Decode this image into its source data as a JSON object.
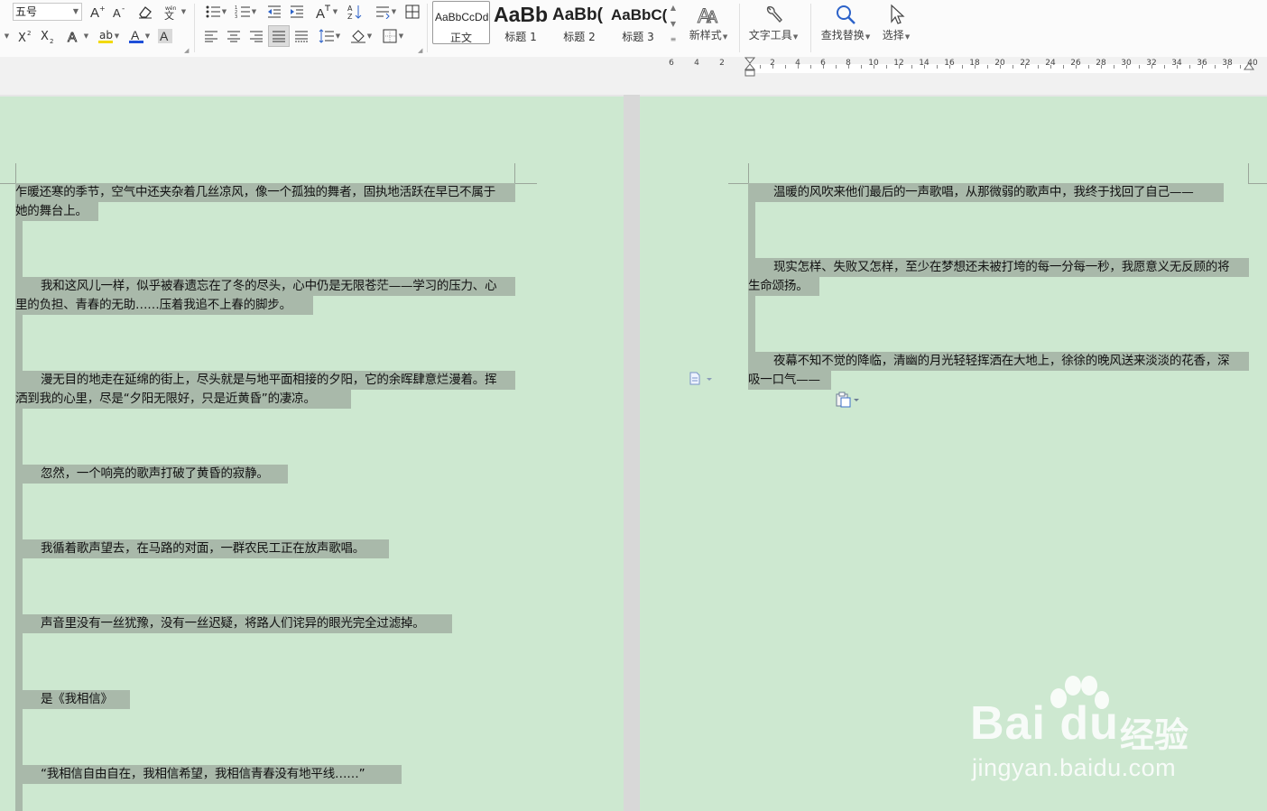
{
  "toolbar": {
    "font_size": "五号",
    "styles": [
      {
        "preview": "AaBbCcDd",
        "label": "正文"
      },
      {
        "preview": "AaBb",
        "label": "标题 1"
      },
      {
        "preview": "AaBb(",
        "label": "标题 2"
      },
      {
        "preview": "AaBbC(",
        "label": "标题 3"
      }
    ],
    "new_style": "新样式",
    "text_tools": "文字工具",
    "find_replace": "查找替换",
    "select": "选择"
  },
  "ruler": {
    "left_numbers": [
      "6",
      "4",
      "2"
    ],
    "right_numbers": [
      "2",
      "4",
      "6",
      "8",
      "10",
      "12",
      "14",
      "16",
      "18",
      "20",
      "22",
      "24",
      "26",
      "28",
      "30",
      "32",
      "34",
      "36",
      "38",
      "40"
    ]
  },
  "left_page": {
    "lines": [
      "乍暖还寒的季节，空气中还夹杂着几丝凉风，像一个孤独的舞者，固执地活跃在早已不属于",
      "她的舞台上。",
      "我和这风儿一样，似乎被春遗忘在了冬的尽头，心中仍是无限苍茫——学习的压力、心",
      "里的负担、青春的无助……压着我追不上春的脚步。",
      "漫无目的地走在延绵的街上，尽头就是与地平面相接的夕阳，它的余晖肆意烂漫着。挥",
      "洒到我的心里，尽是“夕阳无限好，只是近黄昏”的凄凉。",
      "忽然，一个响亮的歌声打破了黄昏的寂静。",
      "我循着歌声望去，在马路的对面，一群农民工正在放声歌唱。",
      "声音里没有一丝犹豫，没有一丝迟疑，将路人们诧异的眼光完全过滤掉。",
      "是《我相信》",
      "“我相信自由自在，我相信希望，我相信青春没有地平线……”"
    ]
  },
  "right_page": {
    "lines": [
      "温暖的风吹来他们最后的一声歌唱，从那微弱的歌声中，我终于找回了自己——",
      "现实怎样、失败又怎样，至少在梦想还未被打垮的每一分每一秒，我愿意义无反顾的将",
      "生命颂扬。",
      "夜幕不知不觉的降临，清幽的月光轻轻挥洒在大地上，徐徐的晚风送来淡淡的花香，深",
      "吸一口气——"
    ]
  },
  "watermark": {
    "logo": "Bai du",
    "cn": "经验",
    "url": "jingyan.baidu.com"
  },
  "colors": {
    "page_bg": "#cde8d0",
    "selection": "#a9b9aa",
    "ribbon_bg": "#fbfbfb"
  }
}
